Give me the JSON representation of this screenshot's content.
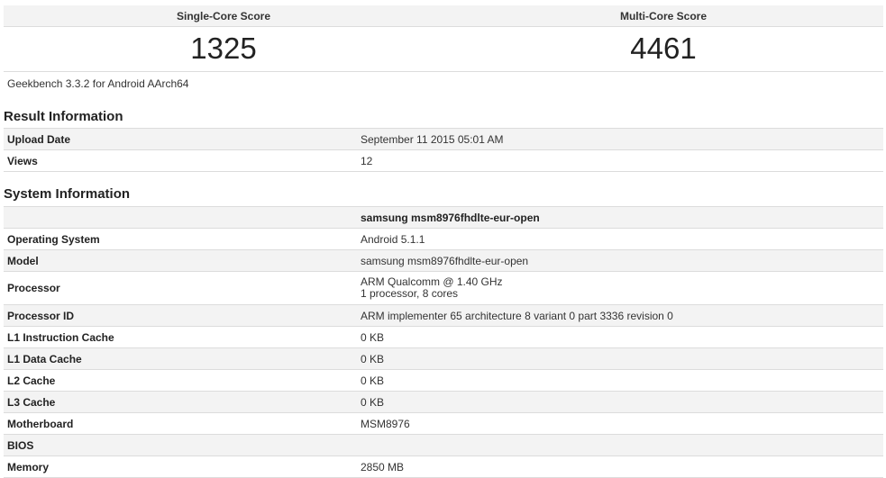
{
  "scores": {
    "single": {
      "label": "Single-Core Score",
      "value": "1325"
    },
    "multi": {
      "label": "Multi-Core Score",
      "value": "4461"
    }
  },
  "version_text": "Geekbench 3.3.2 for Android AArch64",
  "result_info": {
    "title": "Result Information",
    "rows": [
      {
        "key": "Upload Date",
        "value": "September 11 2015 05:01 AM"
      },
      {
        "key": "Views",
        "value": "12"
      }
    ]
  },
  "system_info": {
    "title": "System Information",
    "header_value": "samsung msm8976fhdlte-eur-open",
    "rows": [
      {
        "key": "Operating System",
        "value": "Android 5.1.1"
      },
      {
        "key": "Model",
        "value": "samsung msm8976fhdlte-eur-open"
      },
      {
        "key": "Processor",
        "value": "ARM Qualcomm @ 1.40 GHz",
        "value2": "1 processor, 8 cores"
      },
      {
        "key": "Processor ID",
        "value": "ARM implementer 65 architecture 8 variant 0 part 3336 revision 0"
      },
      {
        "key": "L1 Instruction Cache",
        "value": "0 KB"
      },
      {
        "key": "L1 Data Cache",
        "value": "0 KB"
      },
      {
        "key": "L2 Cache",
        "value": "0 KB"
      },
      {
        "key": "L3 Cache",
        "value": "0 KB"
      },
      {
        "key": "Motherboard",
        "value": "MSM8976"
      },
      {
        "key": "BIOS",
        "value": ""
      },
      {
        "key": "Memory",
        "value": "2850 MB"
      }
    ]
  }
}
